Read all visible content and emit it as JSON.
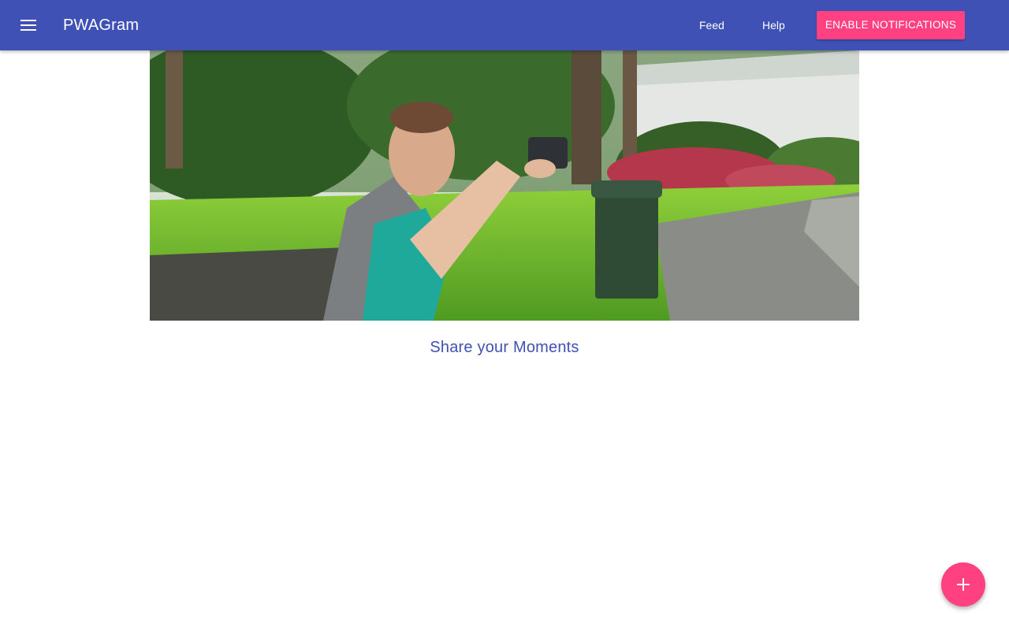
{
  "header": {
    "title": "PWAGram",
    "menu_icon": "menu-icon",
    "nav": {
      "feed_label": "Feed",
      "help_label": "Help"
    },
    "notifications_button_label": "ENABLE NOTIFICATIONS"
  },
  "main": {
    "tagline": "Share your Moments"
  },
  "fab": {
    "icon": "add-icon"
  },
  "colors": {
    "primary": "#3f51b5",
    "accent": "#ff4081",
    "background": "#ffffff"
  }
}
